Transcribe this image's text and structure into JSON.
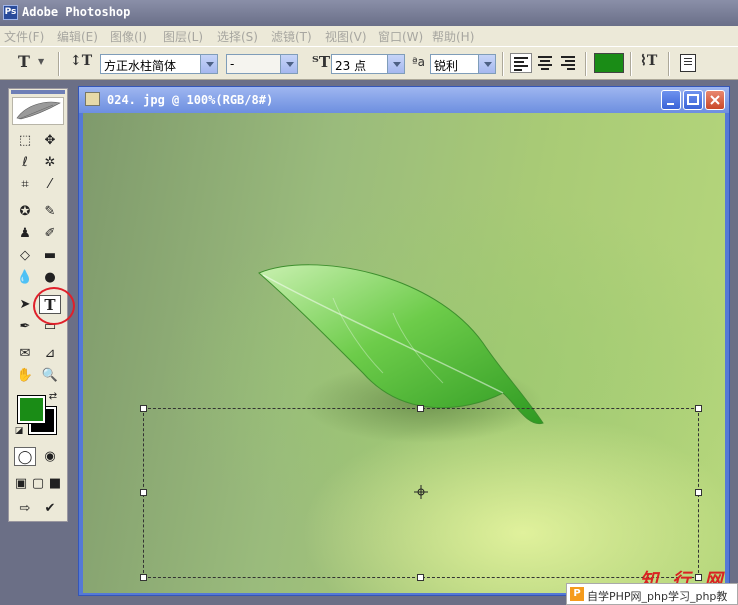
{
  "app": {
    "title": "Adobe Photoshop"
  },
  "menu": [
    "文件(F)",
    "编辑(E)",
    "图像(I)",
    "图层(L)",
    "选择(S)",
    "滤镜(T)",
    "视图(V)",
    "窗口(W)",
    "帮助(H)"
  ],
  "options": {
    "tool_glyph": "T",
    "font_family": "方正水柱简体",
    "font_style": "-",
    "font_size": "23 点",
    "antialias_label": "ªa",
    "antialias": "锐利",
    "text_color": "#1a8c16"
  },
  "toolbox": {
    "foreground_color": "#1a8c16",
    "background_color": "#000000",
    "selected_tool": "T"
  },
  "document": {
    "title": "024. jpg @ 100%(RGB/8#)"
  },
  "watermark": {
    "brand_large": "知 行 网",
    "text": "自学PHP网_php学习_php教"
  }
}
